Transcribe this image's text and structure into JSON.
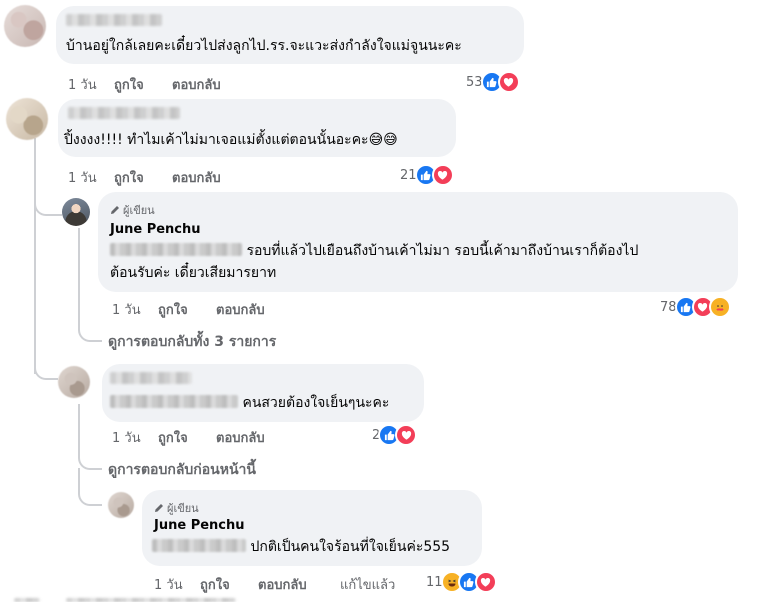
{
  "comments": [
    {
      "text": "บ้านอยู่ใกล้เลยคะเดี๋ยวไปส่งลูกไป.รร.จะแวะส่งกำลังใจแม่จูนนะคะ",
      "time": "1 วัน",
      "like": "ถูกใจ",
      "reply": "ตอบกลับ",
      "reactions": "53"
    },
    {
      "text": "ปิ้งงงง!!!! ทำไมเค้าไม่มาเจอแม่ตั้งแต่ตอนนั้นอะคะ😅😅",
      "time": "1 วัน",
      "like": "ถูกใจ",
      "reply": "ตอบกลับ",
      "reactions": "21"
    }
  ],
  "author_reply_1": {
    "badge": "ผู้เขียน",
    "name": "June Penchu",
    "line1": "รอบที่แล้วไปเยือนถึงบ้านเค้าไม่มา รอบนี้เค้ามาถึงบ้านเราก็ต้องไป",
    "line2": "ต้อนรับค่ะ เดี๋ยวเสียมารยาท",
    "time": "1 วัน",
    "like": "ถูกใจ",
    "reply": "ตอบกลับ",
    "reactions": "78"
  },
  "view_all_replies": "ดูการตอบกลับทั้ง 3 รายการ",
  "reply_2": {
    "text": "คนสวยต้องใจเย็นๆนะคะ",
    "time": "1 วัน",
    "like": "ถูกใจ",
    "reply": "ตอบกลับ",
    "reactions": "2"
  },
  "view_previous": "ดูการตอบกลับก่อนหน้านี้",
  "author_reply_2": {
    "badge": "ผู้เขียน",
    "name": "June Penchu",
    "text": "ปกติเป็นคนใจร้อนที่ใจเย็นค่ะ555",
    "time": "1 วัน",
    "like": "ถูกใจ",
    "reply": "ตอบกลับ",
    "edited": "แก้ไขแล้ว",
    "reactions": "11"
  },
  "icons": {
    "like": "like-reaction-icon",
    "love": "love-reaction-icon",
    "haha": "haha-reaction-icon",
    "care": "care-reaction-icon",
    "author": "pen-icon"
  },
  "colors": {
    "bubble": "#f0f2f5",
    "meta": "#65676b",
    "like": "#1877f2",
    "love": "#f33e58"
  }
}
